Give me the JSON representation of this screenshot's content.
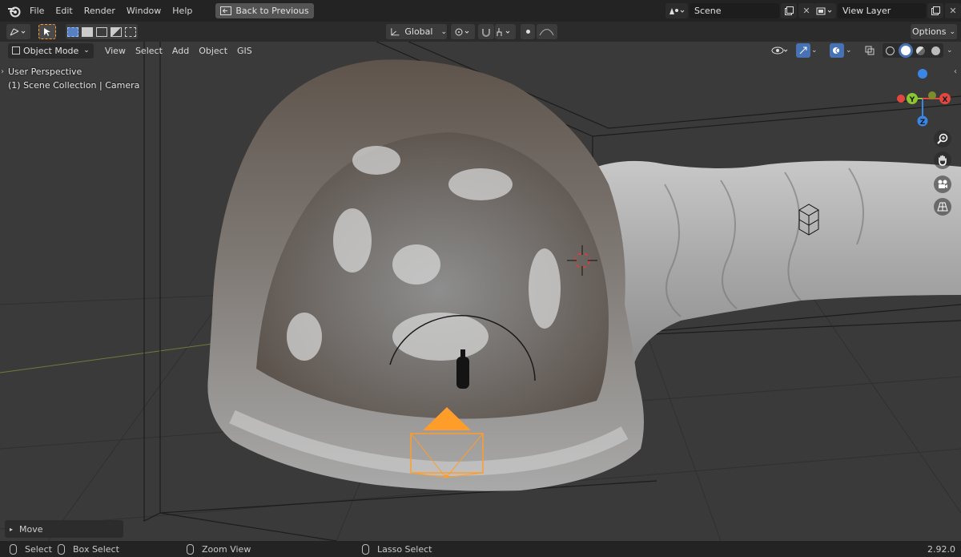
{
  "menu": [
    "File",
    "Edit",
    "Render",
    "Window",
    "Help"
  ],
  "back_button": "Back to Previous",
  "scene": {
    "value": "Scene"
  },
  "view_layer": {
    "value": "View Layer"
  },
  "tool_header": {
    "transform_orientation": "Global",
    "options_label": "Options"
  },
  "viewport_header": {
    "mode": "Object Mode",
    "menus": [
      "View",
      "Select",
      "Add",
      "Object",
      "GIS"
    ]
  },
  "overlay": {
    "perspective": "User Perspective",
    "collection": "(1) Scene Collection | Camera"
  },
  "gizmo": {
    "x": "X",
    "y": "Y",
    "z": "Z"
  },
  "last_operator": "Move",
  "statusbar": {
    "select": "Select",
    "box_select": "Box Select",
    "zoom_view": "Zoom View",
    "lasso_select": "Lasso Select",
    "version": "2.92.0"
  },
  "colors": {
    "accent": "#ff9d2a",
    "axis_x": "#e2483f",
    "axis_y": "#8bc531",
    "axis_z": "#3a86e6"
  }
}
